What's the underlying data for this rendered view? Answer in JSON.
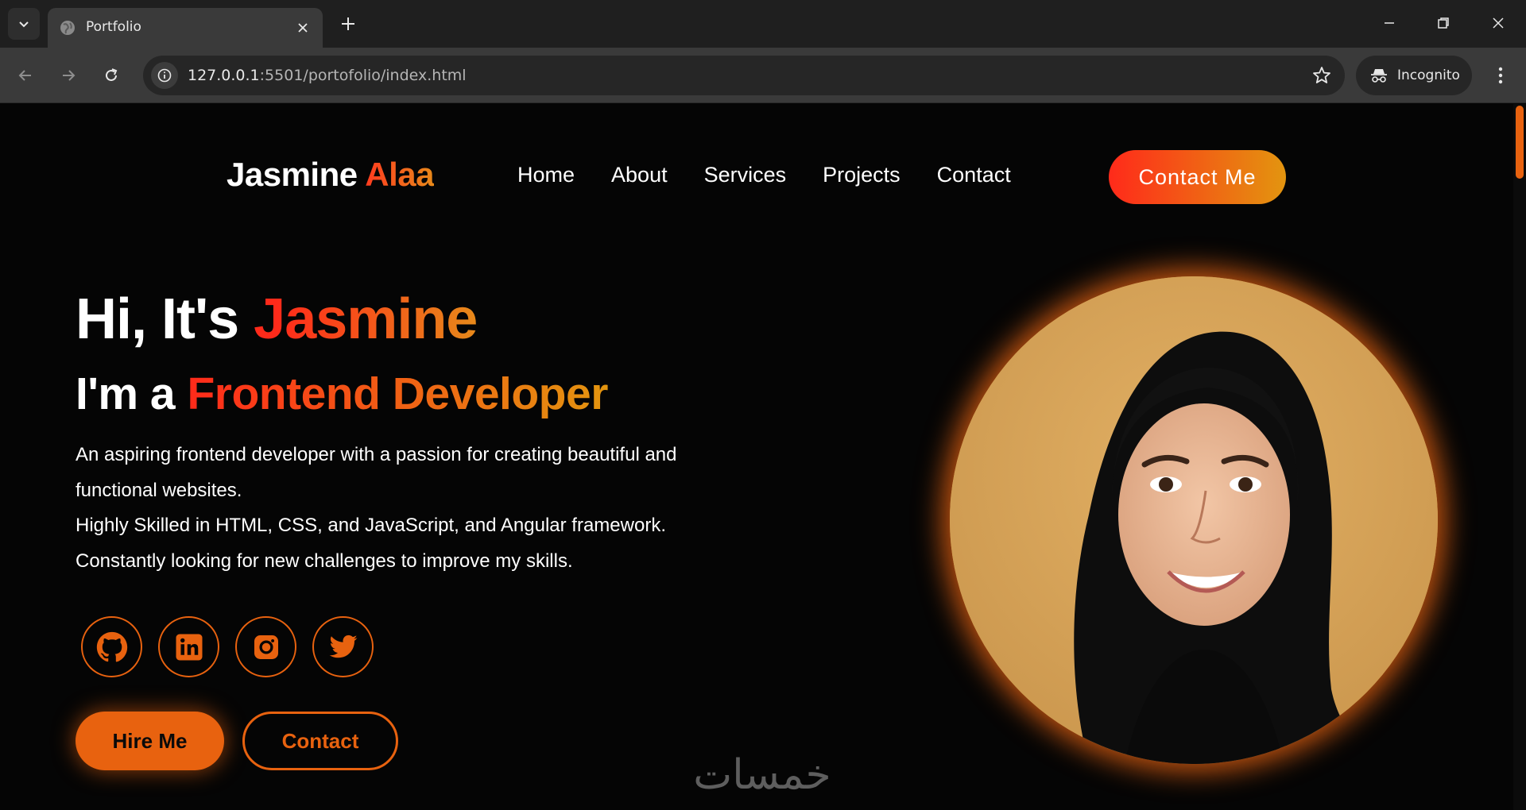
{
  "browser": {
    "tab_title": "Portfolio",
    "url_host": "127.0.0.1",
    "url_rest": ":5501/portofolio/index.html",
    "incognito_label": "Incognito"
  },
  "nav": {
    "logo_first": "Jasmine",
    "logo_last": "Alaa",
    "links": [
      "Home",
      "About",
      "Services",
      "Projects",
      "Contact"
    ],
    "cta": "Contact Me"
  },
  "hero": {
    "greeting_prefix": "Hi, It's",
    "greeting_name": "Jasmine",
    "role_prefix": "I'm a",
    "role": "Frontend Developer",
    "description": [
      "An aspiring frontend developer with a passion for creating beautiful and",
      "functional websites.",
      "Highly Skilled in HTML, CSS, and JavaScript, and Angular framework.",
      "Constantly looking for new challenges to improve my skills."
    ],
    "socials": [
      "github-icon",
      "linkedin-icon",
      "instagram-icon",
      "twitter-icon"
    ],
    "hire_button": "Hire Me",
    "contact_button": "Contact"
  },
  "watermark": {
    "text": "خمسات"
  },
  "colors": {
    "accent": "#e8620f",
    "gradient_start": "#ff2a1a",
    "gradient_end": "#e3950f",
    "background": "#050505",
    "portrait_bg": "#d8a456"
  }
}
